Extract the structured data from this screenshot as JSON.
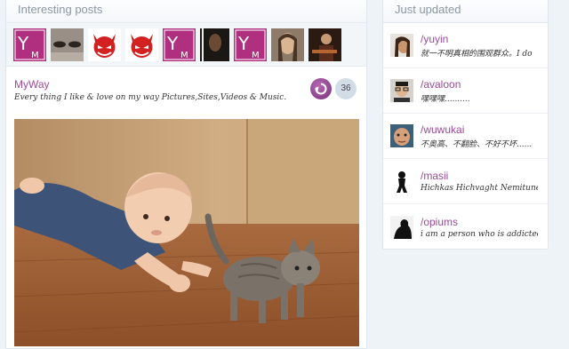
{
  "interesting_posts": {
    "heading": "Interesting posts",
    "thumbnails": [
      {
        "icon": "myway-logo-thumb"
      },
      {
        "icon": "eyes-photo-thumb"
      },
      {
        "icon": "devil-face-thumb"
      },
      {
        "icon": "devil-face-thumb"
      },
      {
        "icon": "myway-logo-thumb"
      },
      {
        "icon": "dark-portrait-thumb"
      },
      {
        "icon": "myway-logo-thumb"
      },
      {
        "icon": "woman-portrait-thumb"
      },
      {
        "icon": "guitarist-photo-thumb"
      }
    ]
  },
  "post": {
    "blog_name": "MyWay",
    "description": "Every thing I like & love on my way Pictures,Sites,Videos & Music.",
    "reblog_icon": "reblog-icon",
    "count": "36",
    "image": "baby-and-kitten-photo"
  },
  "just_updated": {
    "heading": "Just updated",
    "users": [
      {
        "name": "/yuyin",
        "desc": "就一不明真相的围观群众。I do",
        "avatar": "woman-avatar"
      },
      {
        "name": "/avaloon",
        "desc": "嘿嘿嘿..........",
        "avatar": "man-glasses-avatar"
      },
      {
        "name": "/wuwukai",
        "desc": "不奥高、不翻脸、不好不坏......",
        "avatar": "man-face-avatar"
      },
      {
        "name": "/masii",
        "desc": "Hichkas Hichvaght Nemitune",
        "avatar": "silhouette-avatar"
      },
      {
        "name": "/opiums",
        "desc": "i am a person who is addicted",
        "avatar": "dark-figure-avatar"
      }
    ]
  },
  "colors": {
    "accent": "#9b4a9a",
    "background": "#eef3f8",
    "muted_heading": "#8a96a3"
  }
}
